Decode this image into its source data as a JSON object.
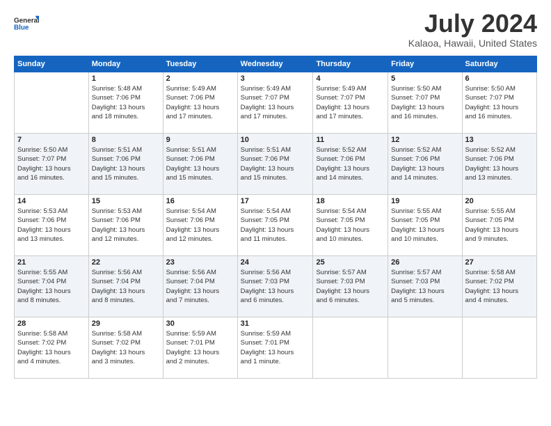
{
  "logo": {
    "line1": "General",
    "line2": "Blue"
  },
  "title": "July 2024",
  "subtitle": "Kalaoa, Hawaii, United States",
  "headers": [
    "Sunday",
    "Monday",
    "Tuesday",
    "Wednesday",
    "Thursday",
    "Friday",
    "Saturday"
  ],
  "weeks": [
    [
      {
        "day": "",
        "info": ""
      },
      {
        "day": "1",
        "info": "Sunrise: 5:48 AM\nSunset: 7:06 PM\nDaylight: 13 hours\nand 18 minutes."
      },
      {
        "day": "2",
        "info": "Sunrise: 5:49 AM\nSunset: 7:06 PM\nDaylight: 13 hours\nand 17 minutes."
      },
      {
        "day": "3",
        "info": "Sunrise: 5:49 AM\nSunset: 7:07 PM\nDaylight: 13 hours\nand 17 minutes."
      },
      {
        "day": "4",
        "info": "Sunrise: 5:49 AM\nSunset: 7:07 PM\nDaylight: 13 hours\nand 17 minutes."
      },
      {
        "day": "5",
        "info": "Sunrise: 5:50 AM\nSunset: 7:07 PM\nDaylight: 13 hours\nand 16 minutes."
      },
      {
        "day": "6",
        "info": "Sunrise: 5:50 AM\nSunset: 7:07 PM\nDaylight: 13 hours\nand 16 minutes."
      }
    ],
    [
      {
        "day": "7",
        "info": "Sunrise: 5:50 AM\nSunset: 7:07 PM\nDaylight: 13 hours\nand 16 minutes."
      },
      {
        "day": "8",
        "info": "Sunrise: 5:51 AM\nSunset: 7:06 PM\nDaylight: 13 hours\nand 15 minutes."
      },
      {
        "day": "9",
        "info": "Sunrise: 5:51 AM\nSunset: 7:06 PM\nDaylight: 13 hours\nand 15 minutes."
      },
      {
        "day": "10",
        "info": "Sunrise: 5:51 AM\nSunset: 7:06 PM\nDaylight: 13 hours\nand 15 minutes."
      },
      {
        "day": "11",
        "info": "Sunrise: 5:52 AM\nSunset: 7:06 PM\nDaylight: 13 hours\nand 14 minutes."
      },
      {
        "day": "12",
        "info": "Sunrise: 5:52 AM\nSunset: 7:06 PM\nDaylight: 13 hours\nand 14 minutes."
      },
      {
        "day": "13",
        "info": "Sunrise: 5:52 AM\nSunset: 7:06 PM\nDaylight: 13 hours\nand 13 minutes."
      }
    ],
    [
      {
        "day": "14",
        "info": "Sunrise: 5:53 AM\nSunset: 7:06 PM\nDaylight: 13 hours\nand 13 minutes."
      },
      {
        "day": "15",
        "info": "Sunrise: 5:53 AM\nSunset: 7:06 PM\nDaylight: 13 hours\nand 12 minutes."
      },
      {
        "day": "16",
        "info": "Sunrise: 5:54 AM\nSunset: 7:06 PM\nDaylight: 13 hours\nand 12 minutes."
      },
      {
        "day": "17",
        "info": "Sunrise: 5:54 AM\nSunset: 7:05 PM\nDaylight: 13 hours\nand 11 minutes."
      },
      {
        "day": "18",
        "info": "Sunrise: 5:54 AM\nSunset: 7:05 PM\nDaylight: 13 hours\nand 10 minutes."
      },
      {
        "day": "19",
        "info": "Sunrise: 5:55 AM\nSunset: 7:05 PM\nDaylight: 13 hours\nand 10 minutes."
      },
      {
        "day": "20",
        "info": "Sunrise: 5:55 AM\nSunset: 7:05 PM\nDaylight: 13 hours\nand 9 minutes."
      }
    ],
    [
      {
        "day": "21",
        "info": "Sunrise: 5:55 AM\nSunset: 7:04 PM\nDaylight: 13 hours\nand 8 minutes."
      },
      {
        "day": "22",
        "info": "Sunrise: 5:56 AM\nSunset: 7:04 PM\nDaylight: 13 hours\nand 8 minutes."
      },
      {
        "day": "23",
        "info": "Sunrise: 5:56 AM\nSunset: 7:04 PM\nDaylight: 13 hours\nand 7 minutes."
      },
      {
        "day": "24",
        "info": "Sunrise: 5:56 AM\nSunset: 7:03 PM\nDaylight: 13 hours\nand 6 minutes."
      },
      {
        "day": "25",
        "info": "Sunrise: 5:57 AM\nSunset: 7:03 PM\nDaylight: 13 hours\nand 6 minutes."
      },
      {
        "day": "26",
        "info": "Sunrise: 5:57 AM\nSunset: 7:03 PM\nDaylight: 13 hours\nand 5 minutes."
      },
      {
        "day": "27",
        "info": "Sunrise: 5:58 AM\nSunset: 7:02 PM\nDaylight: 13 hours\nand 4 minutes."
      }
    ],
    [
      {
        "day": "28",
        "info": "Sunrise: 5:58 AM\nSunset: 7:02 PM\nDaylight: 13 hours\nand 4 minutes."
      },
      {
        "day": "29",
        "info": "Sunrise: 5:58 AM\nSunset: 7:02 PM\nDaylight: 13 hours\nand 3 minutes."
      },
      {
        "day": "30",
        "info": "Sunrise: 5:59 AM\nSunset: 7:01 PM\nDaylight: 13 hours\nand 2 minutes."
      },
      {
        "day": "31",
        "info": "Sunrise: 5:59 AM\nSunset: 7:01 PM\nDaylight: 13 hours\nand 1 minute."
      },
      {
        "day": "",
        "info": ""
      },
      {
        "day": "",
        "info": ""
      },
      {
        "day": "",
        "info": ""
      }
    ]
  ]
}
